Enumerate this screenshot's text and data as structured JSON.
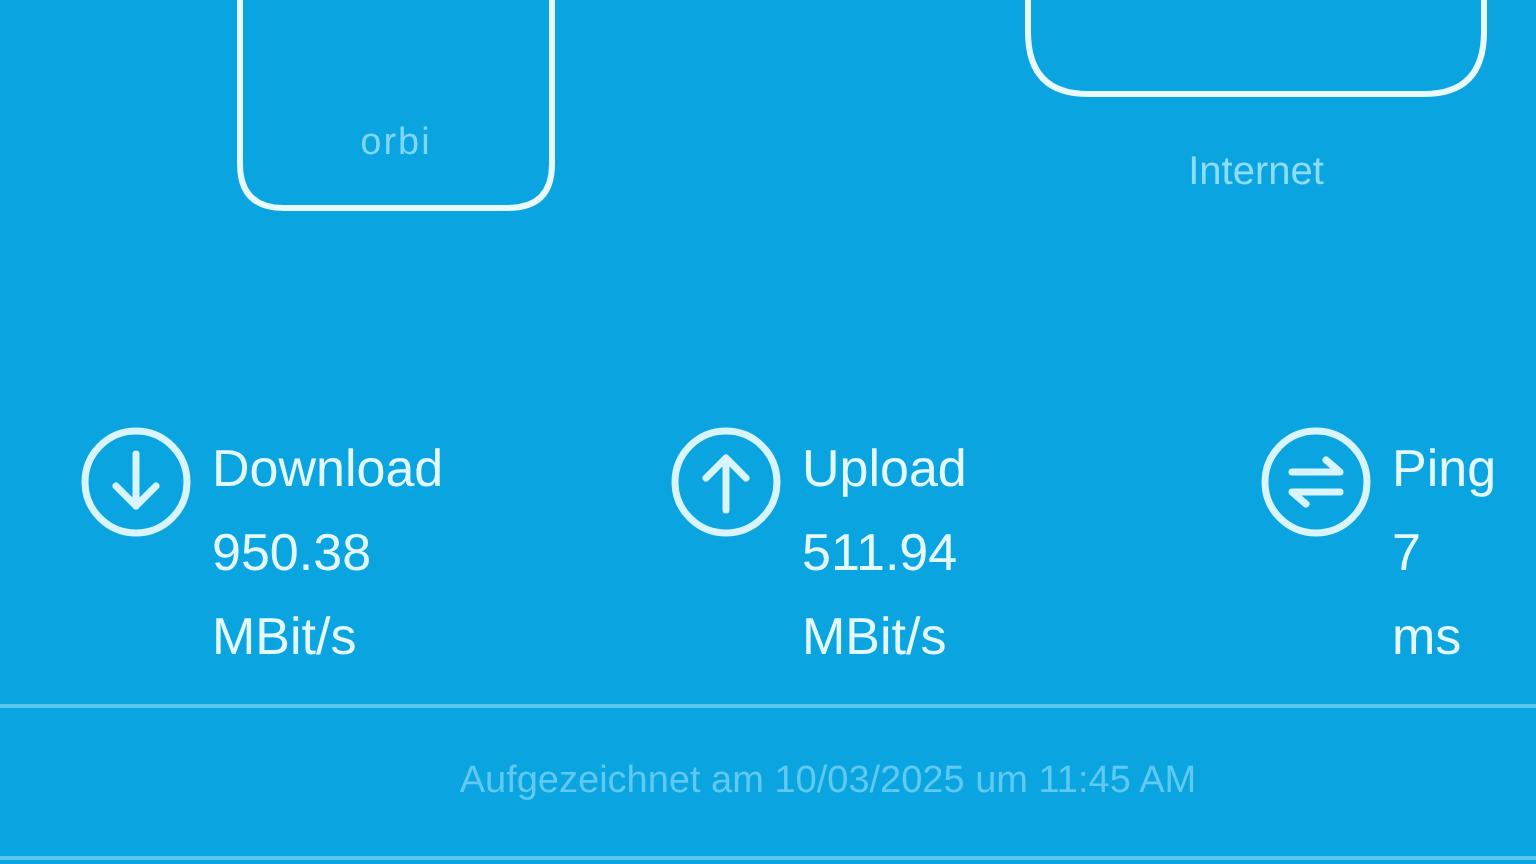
{
  "devices": [
    {
      "kind": "router",
      "label": "orbi"
    },
    {
      "kind": "internet",
      "label": "Internet"
    }
  ],
  "stats": [
    {
      "kind": "download",
      "label": "Download",
      "value": "950.38",
      "unit": "MBit/s"
    },
    {
      "kind": "upload",
      "label": "Upload",
      "value": "511.94",
      "unit": "MBit/s"
    },
    {
      "kind": "ping",
      "label": "Ping",
      "value": "7",
      "unit": "ms"
    }
  ],
  "recorded": "Aufgezeichnet am 10/03/2025 um 11:45 AM"
}
